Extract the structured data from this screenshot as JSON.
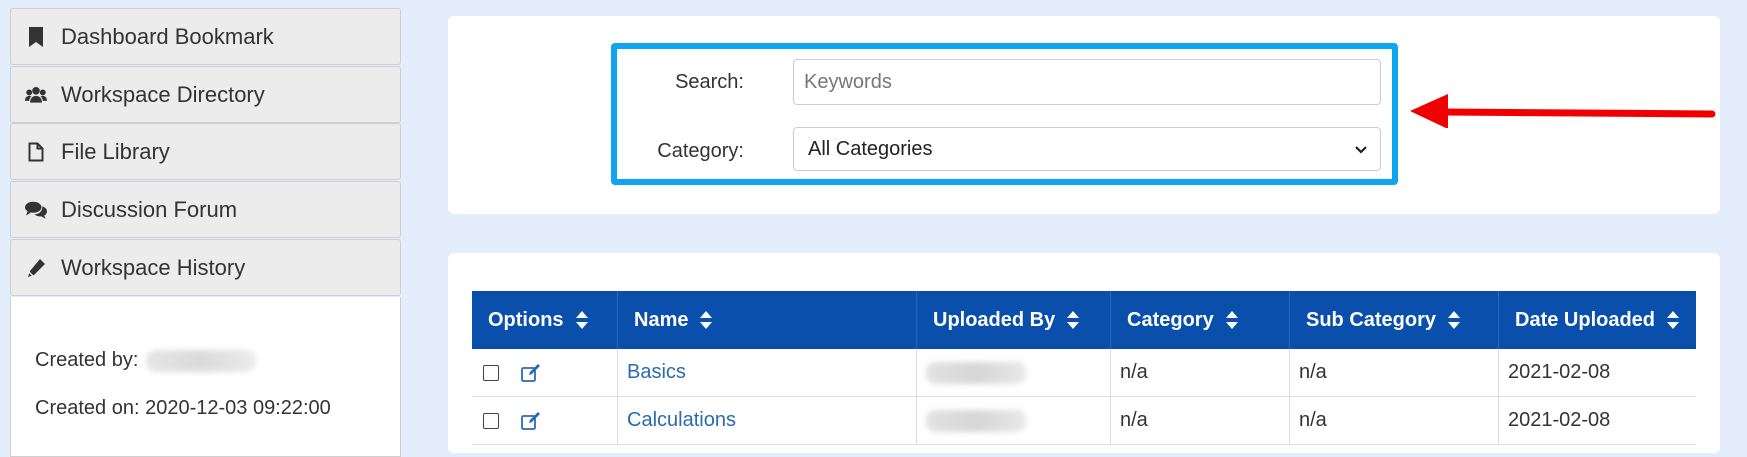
{
  "sidebar": {
    "items": [
      {
        "label": "Dashboard Bookmark",
        "icon": "bookmark-icon"
      },
      {
        "label": "Workspace Directory",
        "icon": "users-icon"
      },
      {
        "label": "File Library",
        "icon": "file-icon"
      },
      {
        "label": "Discussion Forum",
        "icon": "comments-icon"
      },
      {
        "label": "Workspace History",
        "icon": "pencil-icon"
      }
    ],
    "info": {
      "created_by_label": "Created by:",
      "created_on_label": "Created on:",
      "created_on_value": "2020-12-03 09:22:00"
    }
  },
  "search": {
    "search_label": "Search:",
    "search_placeholder": "Keywords",
    "search_value": "",
    "category_label": "Category:",
    "category_selected": "All Categories"
  },
  "colors": {
    "highlight_border": "#10a5f0",
    "arrow": "#f00000",
    "table_header": "#0b4fad",
    "link": "#2a6bb0",
    "page_bg": "#e3edfb"
  },
  "table": {
    "columns": [
      "Options",
      "Name",
      "Uploaded By",
      "Category",
      "Sub Category",
      "Date Uploaded"
    ],
    "rows": [
      {
        "name": "Basics",
        "category": "n/a",
        "sub_category": "n/a",
        "date_uploaded": "2021-02-08"
      },
      {
        "name": "Calculations",
        "category": "n/a",
        "sub_category": "n/a",
        "date_uploaded": "2021-02-08"
      }
    ]
  }
}
